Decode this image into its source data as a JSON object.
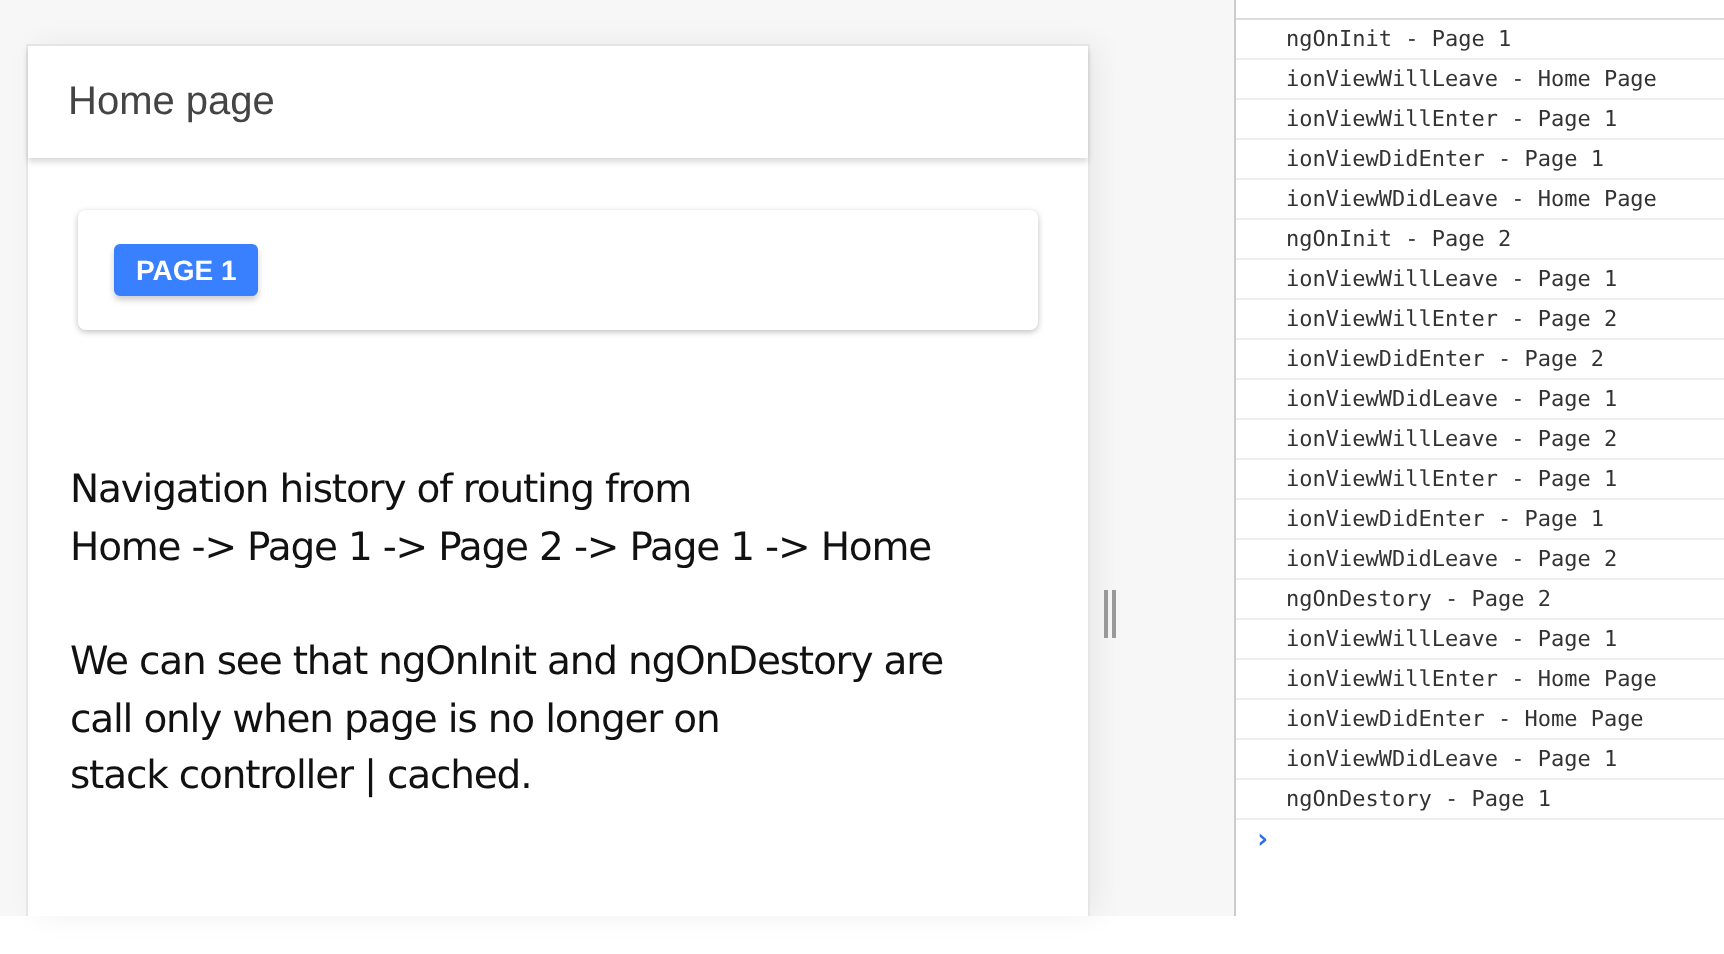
{
  "app": {
    "title": "Home page",
    "button": "PAGE 1",
    "paragraphs": [
      [
        "Navigation history of routing from",
        "Home -> Page 1 -> Page 2 -> Page 1 -> Home"
      ],
      [
        "We can see that ngOnInit and ngOnDestory are",
        "call only when page is no longer on",
        "stack controller | cached."
      ]
    ]
  },
  "console": {
    "messages": [
      "ngOnInit - Page 1",
      "ionViewWillLeave - Home Page",
      "ionViewWillEnter - Page 1",
      "ionViewDidEnter - Page 1",
      "ionViewWDidLeave - Home Page",
      "ngOnInit - Page 2",
      "ionViewWillLeave - Page 1",
      "ionViewWillEnter - Page 2",
      "ionViewDidEnter - Page 2",
      "ionViewWDidLeave - Page 1",
      "ionViewWillLeave - Page 2",
      "ionViewWillEnter - Page 1",
      "ionViewDidEnter - Page 1",
      "ionViewWDidLeave - Page 2",
      "ngOnDestory - Page 2",
      "ionViewWillLeave - Page 1",
      "ionViewWillEnter - Home Page",
      "ionViewDidEnter - Home Page",
      "ionViewWDidLeave - Page 1",
      "ngOnDestory - Page 1"
    ],
    "prompt": "›"
  }
}
